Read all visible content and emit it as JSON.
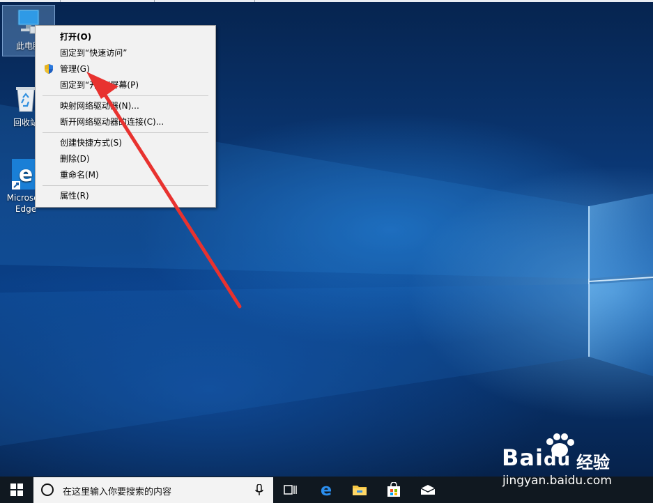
{
  "desktop": {
    "icons": [
      {
        "label": "此电脑",
        "name": "this-pc"
      },
      {
        "label": "回收站",
        "name": "recycle-bin"
      },
      {
        "label": "Microsoft Edge",
        "label_line1": "Microsoft",
        "label_line2": "Edge",
        "name": "edge"
      }
    ]
  },
  "context_menu": {
    "items": [
      {
        "label": "打开(O)",
        "bold": true
      },
      {
        "label": "固定到“快速访问”"
      },
      {
        "label": "管理(G)",
        "icon": "uac-shield-icon"
      },
      {
        "label": "固定到“开始”屏幕(P)"
      },
      {
        "label": "映射网络驱动器(N)..."
      },
      {
        "label": "断开网络驱动器的连接(C)..."
      },
      {
        "label": "创建快捷方式(S)"
      },
      {
        "label": "删除(D)"
      },
      {
        "label": "重命名(M)"
      },
      {
        "label": "属性(R)"
      }
    ]
  },
  "taskbar": {
    "start_icon": "windows-logo-icon",
    "search_placeholder": "在这里输入你要搜索的内容",
    "apps": [
      "task-view-icon",
      "edge-icon",
      "file-explorer-icon",
      "store-icon",
      "mail-icon"
    ]
  },
  "watermark": {
    "brand": "Bai",
    "brand_suffix": "du",
    "cn": "经验",
    "url": "jingyan.baidu.com"
  },
  "colors": {
    "accent": "#0078d7",
    "arrow": "#e8322f",
    "taskbar": "#101820",
    "menu_bg": "#f2f2f2"
  }
}
